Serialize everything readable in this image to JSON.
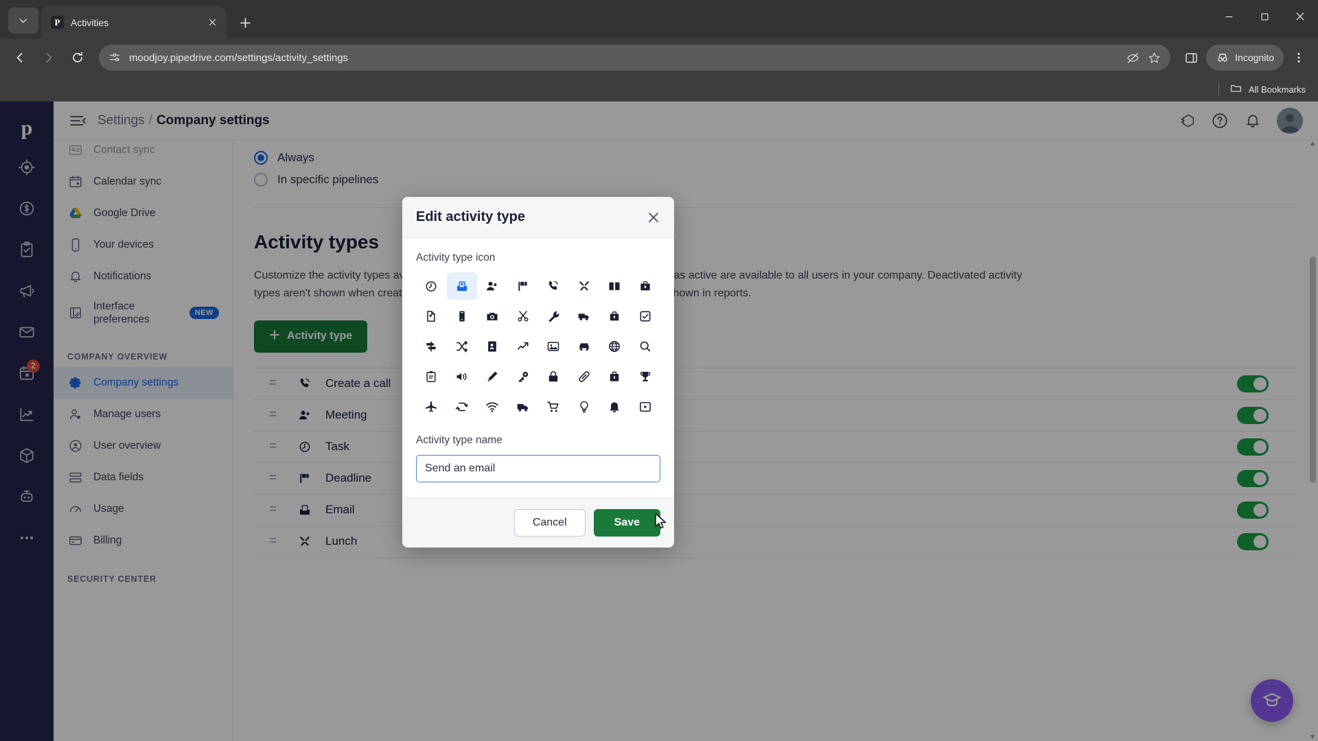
{
  "browser": {
    "tab": {
      "title": "Activities",
      "favicon_letter": "P",
      "favicon_name": "pipedrive-favicon"
    },
    "new_tab_label": "+",
    "url": "moodjoy.pipedrive.com/settings/activity_settings",
    "profile_label": "Incognito",
    "bookmarks_label": "All Bookmarks",
    "window_controls": {
      "minimize": "—",
      "maximize": "☐",
      "close": "✕"
    }
  },
  "rail": {
    "logo": "p",
    "items": [
      {
        "name": "deals-icon"
      },
      {
        "name": "revenue-icon"
      },
      {
        "name": "activities-icon"
      },
      {
        "name": "campaigns-icon"
      },
      {
        "name": "mail-icon"
      },
      {
        "name": "calendar-icon",
        "badge": "2"
      },
      {
        "name": "insights-icon"
      },
      {
        "name": "products-icon"
      },
      {
        "name": "automations-icon"
      },
      {
        "name": "more-icon"
      }
    ]
  },
  "header": {
    "breadcrumb_root": "Settings",
    "breadcrumb_separator": "/",
    "breadcrumb_current": "Company settings"
  },
  "settings_nav": {
    "items": [
      {
        "label": "Contact sync",
        "icon": "contact-sync-icon",
        "state": "partial"
      },
      {
        "label": "Calendar sync",
        "icon": "calendar-sync-icon",
        "state": "normal"
      },
      {
        "label": "Google Drive",
        "icon": "google-drive-icon",
        "state": "normal"
      },
      {
        "label": "Your devices",
        "icon": "devices-icon",
        "state": "normal"
      },
      {
        "label": "Notifications",
        "icon": "bell-icon",
        "state": "normal"
      },
      {
        "label": "Interface preferences",
        "icon": "interface-icon",
        "state": "normal",
        "badge": "NEW"
      }
    ],
    "section_title": "COMPANY OVERVIEW",
    "section_items": [
      {
        "label": "Company settings",
        "icon": "gear-icon",
        "state": "active"
      },
      {
        "label": "Manage users",
        "icon": "manage-users-icon",
        "state": "normal"
      },
      {
        "label": "User overview",
        "icon": "user-overview-icon",
        "state": "normal"
      },
      {
        "label": "Data fields",
        "icon": "data-fields-icon",
        "state": "normal"
      },
      {
        "label": "Usage",
        "icon": "usage-icon",
        "state": "normal"
      },
      {
        "label": "Billing",
        "icon": "billing-icon",
        "state": "normal"
      }
    ],
    "section_title_2": "SECURITY CENTER"
  },
  "main": {
    "radio_options": [
      {
        "label": "Always",
        "selected": true
      },
      {
        "label": "In specific pipelines",
        "selected": false
      }
    ],
    "section_heading": "Activity types",
    "description": "Customize the activity types available to users in your company. Activity types marked as active are available to all users in your company. Deactivated activity types aren't shown when creating activities but can be used to filter activities and are shown in reports.",
    "add_button_label": "Activity type",
    "add_button_icon": "plus-icon",
    "rows": [
      {
        "label": "Create a call",
        "icon": "phone-icon",
        "enabled": true
      },
      {
        "label": "Meeting",
        "icon": "people-icon",
        "enabled": true
      },
      {
        "label": "Task",
        "icon": "clock-icon",
        "enabled": true
      },
      {
        "label": "Deadline",
        "icon": "flag-icon",
        "enabled": true
      },
      {
        "label": "Email",
        "icon": "email-icon",
        "enabled": true
      },
      {
        "label": "Lunch",
        "icon": "lunch-icon",
        "enabled": true
      }
    ]
  },
  "modal": {
    "title": "Edit activity type",
    "close_icon": "close-icon",
    "icon_field_label": "Activity type icon",
    "name_field_label": "Activity type name",
    "name_value": "Send an email",
    "name_placeholder": "Activity type name",
    "cancel_label": "Cancel",
    "save_label": "Save",
    "selected_icon_index": 1,
    "icons": [
      "clock-icon",
      "email-inbox-icon",
      "people-icon",
      "flag-icon",
      "phone-icon",
      "lunch-icon",
      "book-icon",
      "briefcase-icon",
      "file-icon",
      "mobile-icon",
      "camera-icon",
      "scissors-icon",
      "wrench-icon",
      "van-icon",
      "bag-icon",
      "checkbox-icon",
      "signpost-icon",
      "shuffle-icon",
      "contact-card-icon",
      "trend-icon",
      "image-icon",
      "car-icon",
      "globe-icon",
      "search-icon",
      "clipboard-icon",
      "speaker-icon",
      "pen-icon",
      "key-icon",
      "lock-icon",
      "bandage-icon",
      "suitcase-icon",
      "trophy-icon",
      "airplane-icon",
      "repeat-icon",
      "wifi-icon",
      "truck-icon",
      "cart-icon",
      "bulb-icon",
      "bell-icon",
      "video-icon"
    ]
  },
  "colors": {
    "brand_navy": "#26264f",
    "accent_blue": "#1c6ae4",
    "green": "#1a7a3c",
    "toggle_green": "#1a9e47",
    "badge_red": "#e74c3c",
    "fab_purple": "#8b5cf6"
  }
}
